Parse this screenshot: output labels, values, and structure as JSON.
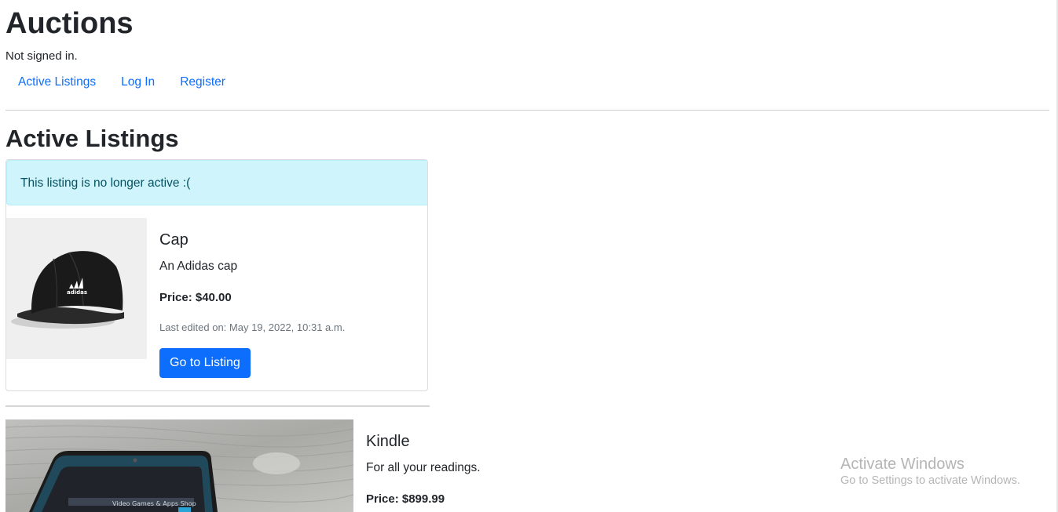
{
  "header": {
    "site_title": "Auctions",
    "signin_status": "Not signed in."
  },
  "nav": {
    "items": [
      {
        "label": "Active Listings"
      },
      {
        "label": "Log In"
      },
      {
        "label": "Register"
      }
    ]
  },
  "main": {
    "section_title": "Active Listings",
    "listings": [
      {
        "alert": "This listing is no longer active :(",
        "image_icon": "adidas-cap-photo",
        "name": "Cap",
        "description": "An Adidas cap",
        "price": "Price: $40.00",
        "last_edited": "Last edited on: May 19, 2022, 10:31 a.m.",
        "button_label": "Go to Listing"
      },
      {
        "image_icon": "kindle-tablet-photo",
        "name": "Kindle",
        "description": "For all your readings.",
        "price": "Price: $899.99"
      }
    ]
  },
  "watermark": {
    "title": "Activate Windows",
    "subtitle": "Go to Settings to activate Windows."
  },
  "colors": {
    "link": "#0d6efd",
    "alert_bg": "#cff4fc",
    "alert_text": "#055160",
    "button_bg": "#0d6efd"
  }
}
